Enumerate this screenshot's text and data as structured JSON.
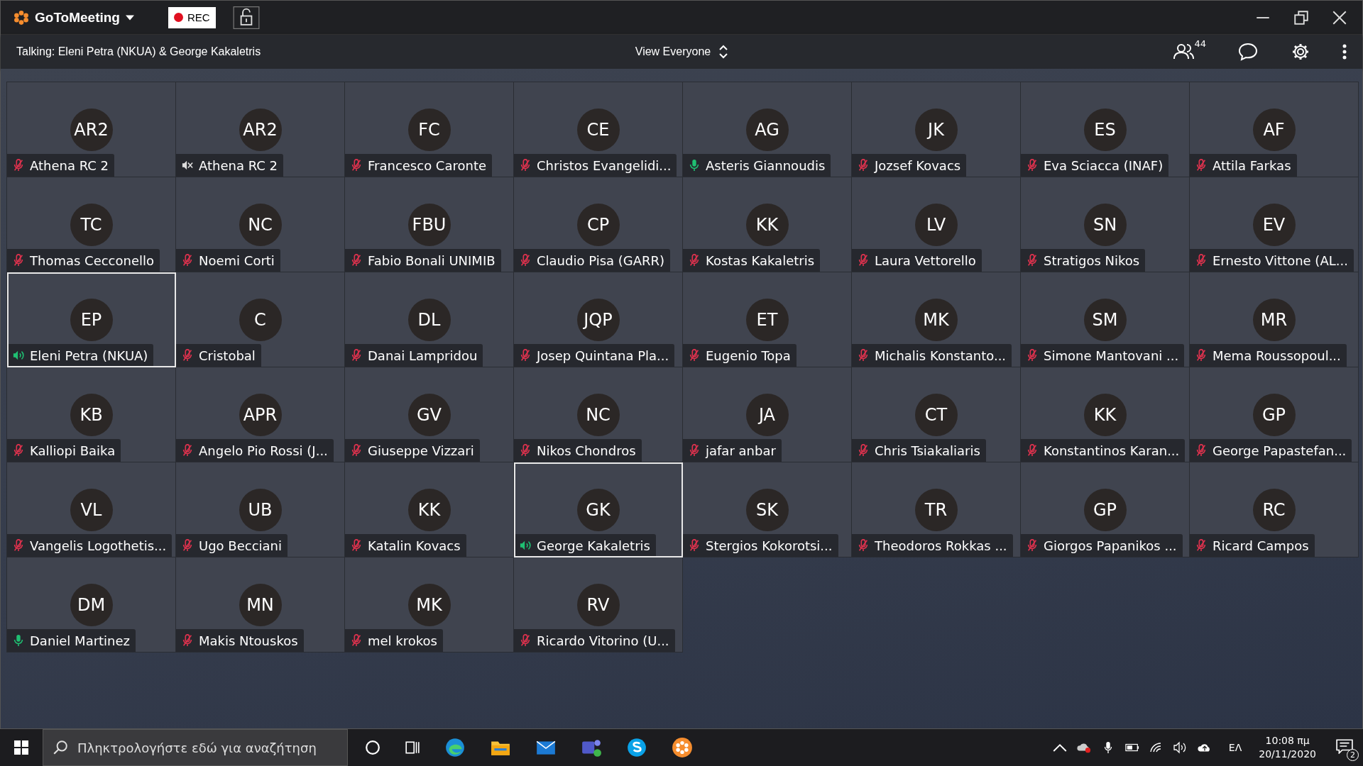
{
  "title_bar": {
    "app_name": "GoToMeeting",
    "rec_label": "REC"
  },
  "talking_bar": {
    "talking": "Talking: Eleni Petra (NKUA) & George Kakaletris",
    "view": "View Everyone",
    "participant_count": "44"
  },
  "participants": [
    {
      "initials": "AR2",
      "name": "Athena RC 2",
      "kind": "muted",
      "active_speaker": false
    },
    {
      "initials": "AR2",
      "name": "Athena RC 2",
      "kind": "no-audio",
      "active_speaker": false
    },
    {
      "initials": "FC",
      "name": "Francesco Caronte",
      "kind": "muted",
      "active_speaker": false
    },
    {
      "initials": "CE",
      "name": "Christos Evangelidi...",
      "kind": "muted",
      "active_speaker": false
    },
    {
      "initials": "AG",
      "name": "Asteris Giannoudis",
      "kind": "mic-on",
      "active_speaker": false
    },
    {
      "initials": "JK",
      "name": "Jozsef Kovacs",
      "kind": "muted",
      "active_speaker": false
    },
    {
      "initials": "ES",
      "name": "Eva Sciacca (INAF)",
      "kind": "muted",
      "active_speaker": false
    },
    {
      "initials": "AF",
      "name": "Attila Farkas",
      "kind": "muted",
      "active_speaker": false
    },
    {
      "initials": "TC",
      "name": "Thomas Cecconello",
      "kind": "muted",
      "active_speaker": false
    },
    {
      "initials": "NC",
      "name": "Noemi Corti",
      "kind": "muted",
      "active_speaker": false
    },
    {
      "initials": "FBU",
      "name": "Fabio Bonali UNIMIB",
      "kind": "muted",
      "active_speaker": false
    },
    {
      "initials": "CP",
      "name": "Claudio Pisa (GARR)",
      "kind": "muted",
      "active_speaker": false
    },
    {
      "initials": "KK",
      "name": "Kostas Kakaletris",
      "kind": "muted",
      "active_speaker": false
    },
    {
      "initials": "LV",
      "name": "Laura Vettorello",
      "kind": "muted",
      "active_speaker": false
    },
    {
      "initials": "SN",
      "name": "Stratigos Nikos",
      "kind": "muted",
      "active_speaker": false
    },
    {
      "initials": "EV",
      "name": "Ernesto Vittone (AL...",
      "kind": "muted",
      "active_speaker": false
    },
    {
      "initials": "EP",
      "name": "Eleni Petra (NKUA)",
      "kind": "speaking",
      "active_speaker": true
    },
    {
      "initials": "C",
      "name": "Cristobal",
      "kind": "muted",
      "active_speaker": false
    },
    {
      "initials": "DL",
      "name": "Danai Lampridou",
      "kind": "muted",
      "active_speaker": false
    },
    {
      "initials": "JQP",
      "name": "Josep Quintana Pla...",
      "kind": "muted",
      "active_speaker": false
    },
    {
      "initials": "ET",
      "name": "Eugenio Topa",
      "kind": "muted",
      "active_speaker": false
    },
    {
      "initials": "MK",
      "name": "Michalis Konstanto...",
      "kind": "muted",
      "active_speaker": false
    },
    {
      "initials": "SM",
      "name": "Simone Mantovani ...",
      "kind": "muted",
      "active_speaker": false
    },
    {
      "initials": "MR",
      "name": "Mema Roussopoul...",
      "kind": "muted",
      "active_speaker": false
    },
    {
      "initials": "KB",
      "name": "Kalliopi Baika",
      "kind": "muted",
      "active_speaker": false
    },
    {
      "initials": "APR",
      "name": "Angelo Pio Rossi (J...",
      "kind": "muted",
      "active_speaker": false
    },
    {
      "initials": "GV",
      "name": "Giuseppe Vizzari",
      "kind": "muted",
      "active_speaker": false
    },
    {
      "initials": "NC",
      "name": "Nikos Chondros",
      "kind": "muted",
      "active_speaker": false
    },
    {
      "initials": "JA",
      "name": "jafar anbar",
      "kind": "muted",
      "active_speaker": false
    },
    {
      "initials": "CT",
      "name": "Chris Tsiakaliaris",
      "kind": "muted",
      "active_speaker": false
    },
    {
      "initials": "KK",
      "name": "Konstantinos Karan...",
      "kind": "muted",
      "active_speaker": false
    },
    {
      "initials": "GP",
      "name": "George Papastefan...",
      "kind": "muted",
      "active_speaker": false
    },
    {
      "initials": "VL",
      "name": "Vangelis Logothetis...",
      "kind": "muted",
      "active_speaker": false
    },
    {
      "initials": "UB",
      "name": "Ugo Becciani",
      "kind": "muted",
      "active_speaker": false
    },
    {
      "initials": "KK",
      "name": "Katalin Kovacs",
      "kind": "muted",
      "active_speaker": false
    },
    {
      "initials": "GK",
      "name": "George Kakaletris",
      "kind": "speaking",
      "active_speaker": true
    },
    {
      "initials": "SK",
      "name": "Stergios Kokorotsi...",
      "kind": "muted",
      "active_speaker": false
    },
    {
      "initials": "TR",
      "name": "Theodoros Rokkas ...",
      "kind": "muted",
      "active_speaker": false
    },
    {
      "initials": "GP",
      "name": "Giorgos Papanikos ...",
      "kind": "muted",
      "active_speaker": false
    },
    {
      "initials": "RC",
      "name": "Ricard Campos",
      "kind": "muted",
      "active_speaker": false
    },
    {
      "initials": "DM",
      "name": "Daniel Martinez",
      "kind": "mic-on",
      "active_speaker": false
    },
    {
      "initials": "MN",
      "name": "Makis Ntouskos",
      "kind": "muted",
      "active_speaker": false
    },
    {
      "initials": "MK",
      "name": "mel krokos",
      "kind": "muted",
      "active_speaker": false
    },
    {
      "initials": "RV",
      "name": "Ricardo Vitorino (U...",
      "kind": "muted",
      "active_speaker": false
    }
  ],
  "taskbar": {
    "search_placeholder": "Πληκτρολογήστε εδώ για αναζήτηση",
    "language": "ΕΛ",
    "time": "10:08 πμ",
    "date": "20/11/2020",
    "notification_count": "2"
  }
}
